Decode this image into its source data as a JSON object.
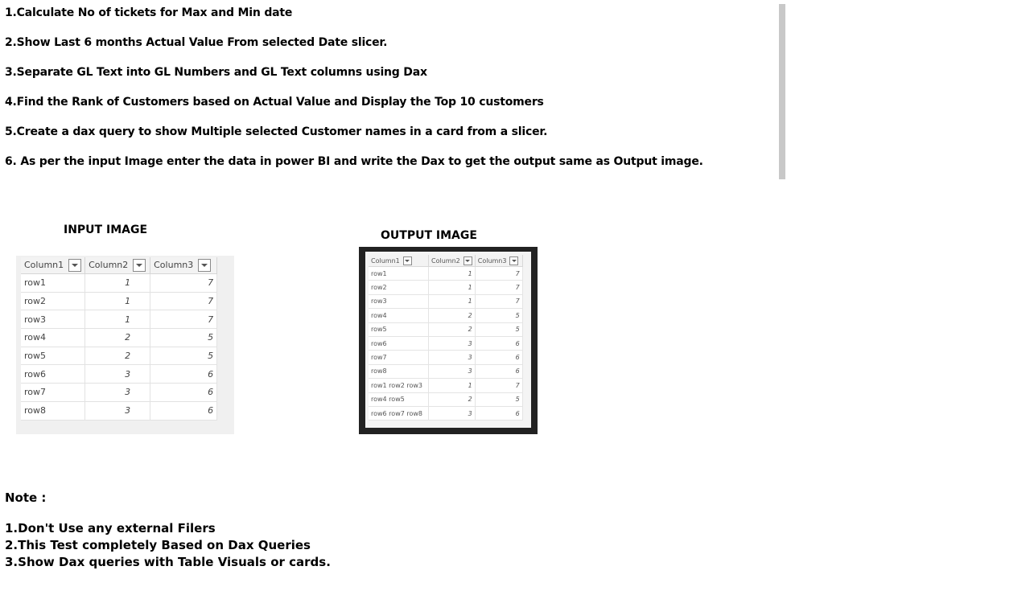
{
  "tasks": [
    "1.Calculate No of tickets for  Max and Min date",
    "2.Show Last 6 months Actual Value  From selected Date slicer.",
    "3.Separate GL Text into GL Numbers and GL Text columns using Dax",
    "4.Find the Rank of Customers based on Actual Value and Display the Top 10 customers",
    "5.Create a dax query to show Multiple selected Customer names in a card from a slicer.",
    "6. As per the input Image enter the data in power BI and write the Dax to get the output same as Output image."
  ],
  "input_image": {
    "caption": "INPUT IMAGE",
    "headers": [
      "Column1",
      "Column2",
      "Column3"
    ],
    "rows": [
      [
        "row1",
        "1",
        "7"
      ],
      [
        "row2",
        "1",
        "7"
      ],
      [
        "row3",
        "1",
        "7"
      ],
      [
        "row4",
        "2",
        "5"
      ],
      [
        "row5",
        "2",
        "5"
      ],
      [
        "row6",
        "3",
        "6"
      ],
      [
        "row7",
        "3",
        "6"
      ],
      [
        "row8",
        "3",
        "6"
      ]
    ]
  },
  "output_image": {
    "caption": "OUTPUT IMAGE",
    "headers": [
      "Column1",
      "Column2",
      "Column3"
    ],
    "rows": [
      [
        "row1",
        "1",
        "7"
      ],
      [
        "row2",
        "1",
        "7"
      ],
      [
        "row3",
        "1",
        "7"
      ],
      [
        "row4",
        "2",
        "5"
      ],
      [
        "row5",
        "2",
        "5"
      ],
      [
        "row6",
        "3",
        "6"
      ],
      [
        "row7",
        "3",
        "6"
      ],
      [
        "row8",
        "3",
        "6"
      ],
      [
        "row1 row2 row3",
        "1",
        "7"
      ],
      [
        "row4 row5",
        "2",
        "5"
      ],
      [
        "row6 row7 row8",
        "3",
        "6"
      ]
    ]
  },
  "note": {
    "title": "Note :",
    "lines": [
      "1.Don't Use any external Filers",
      "2.This Test completely Based on Dax Queries",
      "3.Show Dax queries with Table Visuals or cards."
    ]
  }
}
